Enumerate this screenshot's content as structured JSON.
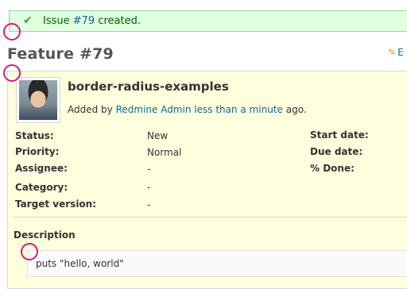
{
  "flash": {
    "prefix": "Issue ",
    "issue_link": "#79",
    "suffix": " created."
  },
  "issue": {
    "title": "Feature #79",
    "edit_label": "E",
    "subject": "border-radius-examples",
    "added_by_prefix": "Added by ",
    "author": "Redmine Admin",
    "time_link": "less than a minute",
    "added_by_suffix": " ago.",
    "attributes": {
      "status_label": "Status:",
      "status_value": "New",
      "priority_label": "Priority:",
      "priority_value": "Normal",
      "assignee_label": "Assignee:",
      "assignee_value": "-",
      "category_label": "Category:",
      "category_value": "-",
      "target_version_label": "Target version:",
      "target_version_value": "-",
      "start_date_label": "Start date:",
      "due_date_label": "Due date:",
      "done_label": "% Done:"
    },
    "description_label": "Description",
    "description_code": "puts \"hello, world\""
  },
  "colors": {
    "link": "#116699",
    "flash_bg": "#dfffdf",
    "issue_bg": "#ffffdd",
    "ring": "#d21a8c"
  },
  "icons": {
    "flash": "checkmark-icon",
    "edit": "pencil-icon"
  }
}
